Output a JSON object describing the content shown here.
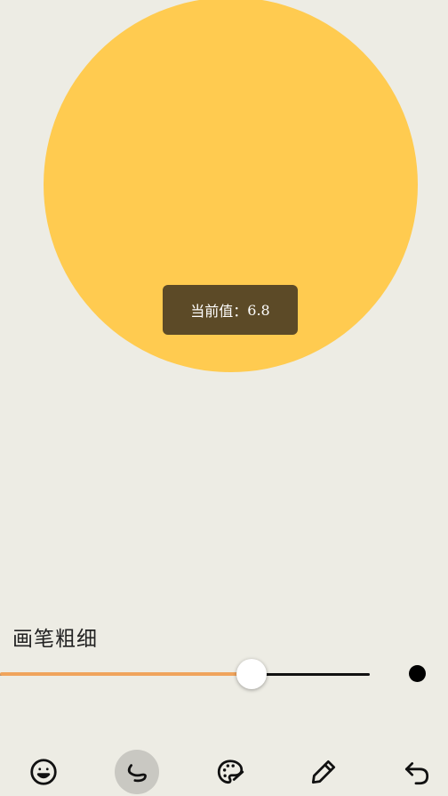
{
  "tooltip": {
    "label": "当前值：",
    "value": "6.8"
  },
  "brush": {
    "title": "画笔粗细",
    "value_fraction": 0.68
  },
  "colors": {
    "background": "#EDECE4",
    "circle": "#FFCB50",
    "tooltip_bg": "#5C4A27",
    "slider_fill": "#F0A45C",
    "active_tool": "#C9C8C2"
  },
  "toolbar": {
    "tools": [
      {
        "icon": "emoji-icon",
        "active": false
      },
      {
        "icon": "freehand-curve-icon",
        "active": true
      },
      {
        "icon": "palette-icon",
        "active": false
      },
      {
        "icon": "pencil-icon",
        "active": false
      },
      {
        "icon": "undo-icon",
        "active": false
      }
    ]
  }
}
